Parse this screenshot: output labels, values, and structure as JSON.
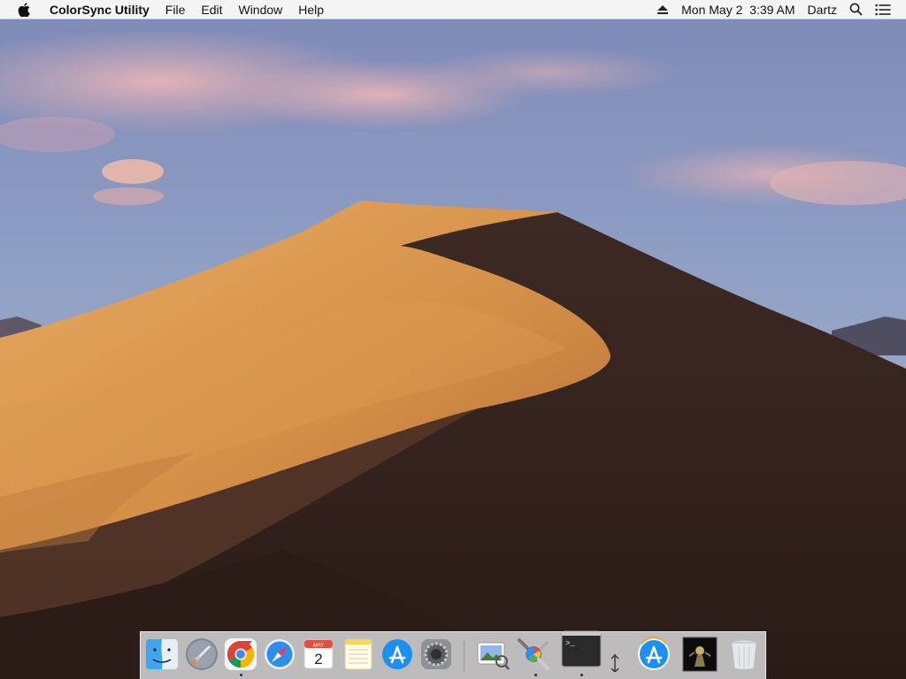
{
  "menubar": {
    "apple_icon": "apple-logo-icon",
    "app_name": "ColorSync Utility",
    "menus": [
      "File",
      "Edit",
      "Window",
      "Help"
    ],
    "status": {
      "eject_icon": "eject-icon",
      "datetime": "Mon May 2  3:39 AM",
      "user": "Dartz",
      "spotlight_icon": "spotlight-search-icon",
      "notification_icon": "notification-center-icon"
    }
  },
  "dock": {
    "items": [
      {
        "name": "Finder",
        "icon": "finder-icon",
        "running": false
      },
      {
        "name": "Launchpad",
        "icon": "launchpad-rocket-icon",
        "running": false
      },
      {
        "name": "Google Chrome",
        "icon": "chrome-icon",
        "running": true
      },
      {
        "name": "Safari",
        "icon": "safari-compass-icon",
        "running": false
      },
      {
        "name": "Calendar",
        "icon": "calendar-icon",
        "running": false,
        "month": "MAY",
        "day": "2"
      },
      {
        "name": "Notes",
        "icon": "notes-icon",
        "running": false
      },
      {
        "name": "App Store",
        "icon": "app-store-icon",
        "running": false
      },
      {
        "name": "System Preferences",
        "icon": "system-preferences-gear-icon",
        "running": false
      },
      {
        "name": "Preview",
        "icon": "preview-icon",
        "running": false
      },
      {
        "name": "ColorSync Utility",
        "icon": "colorsync-utility-icon",
        "running": true
      },
      {
        "name": "Terminal",
        "icon": "terminal-icon",
        "running": true,
        "prompt": ">_"
      },
      {
        "name": "Downloads",
        "icon": "resize-arrows-icon",
        "running": false
      },
      {
        "name": "App Store Download",
        "icon": "app-store-download-icon",
        "running": false
      },
      {
        "name": "Album",
        "icon": "album-cover-icon",
        "running": false
      },
      {
        "name": "Trash",
        "icon": "trash-icon",
        "running": false
      }
    ]
  },
  "wallpaper": {
    "name": "Mojave Day",
    "colors": {
      "sky_top": "#7b88b6",
      "sky_bottom": "#a9b8cf",
      "sand_lit": "#e0a45a",
      "sand_shadow": "#3a2620"
    }
  }
}
